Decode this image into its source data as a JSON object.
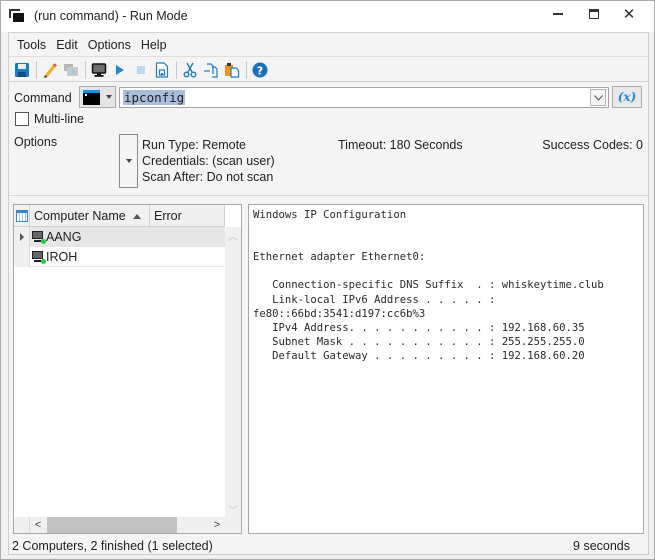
{
  "window": {
    "title": "(run command) - Run Mode",
    "controls": {
      "minimize": "minimize",
      "maximize": "maximize",
      "close": "close"
    }
  },
  "menu": [
    "Tools",
    "Edit",
    "Options",
    "Help"
  ],
  "toolbar": {
    "buttons": [
      {
        "name": "save",
        "icon": "floppy-disk-icon"
      },
      {
        "name": "edit",
        "icon": "pencil-icon"
      },
      {
        "name": "run-on-selected",
        "icon": "window-play-icon",
        "disabled": true
      },
      {
        "name": "computer",
        "icon": "monitor-icon"
      },
      {
        "name": "run",
        "icon": "play-icon"
      },
      {
        "name": "stop",
        "icon": "stop-icon",
        "disabled": true
      },
      {
        "name": "save-output",
        "icon": "document-save-icon"
      },
      {
        "name": "cut",
        "icon": "scissors-icon"
      },
      {
        "name": "copy",
        "icon": "copy-icon"
      },
      {
        "name": "paste",
        "icon": "paste-icon"
      },
      {
        "name": "help",
        "icon": "help-icon"
      }
    ]
  },
  "command": {
    "label": "Command",
    "type_icon": "terminal-icon",
    "value": "ipconfig",
    "variables_label": "(x)"
  },
  "multiline": {
    "label": "Multi-line",
    "checked": false
  },
  "options": {
    "label": "Options",
    "run_type": "Run Type: Remote",
    "credentials": "Credentials: (scan user)",
    "scan_after": "Scan After: Do not scan",
    "timeout": "Timeout: 180 Seconds",
    "success_codes": "Success Codes: 0"
  },
  "grid": {
    "columns": [
      "Computer Name",
      "Error"
    ],
    "sort": {
      "column": "Computer Name",
      "direction": "ascending"
    },
    "rows": [
      {
        "name": "AANG",
        "error": "",
        "status": "online",
        "selected": true
      },
      {
        "name": "IROH",
        "error": "",
        "status": "online",
        "selected": false
      }
    ]
  },
  "output": {
    "text": "Windows IP Configuration\n\n\nEthernet adapter Ethernet0:\n\n   Connection-specific DNS Suffix  . : whiskeytime.club\n   Link-local IPv6 Address . . . . . :\nfe80::66bd:3541:d197:cc6b%3\n   IPv4 Address. . . . . . . . . . . : 192.168.60.35\n   Subnet Mask . . . . . . . . . . . : 255.255.255.0\n   Default Gateway . . . . . . . . . : 192.168.60.20"
  },
  "status": {
    "summary": "2 Computers, 2 finished (1 selected)",
    "elapsed": "9 seconds"
  },
  "colors": {
    "accent": "#1a8bd0",
    "online": "#22c940",
    "selection": "#a8bedc"
  }
}
